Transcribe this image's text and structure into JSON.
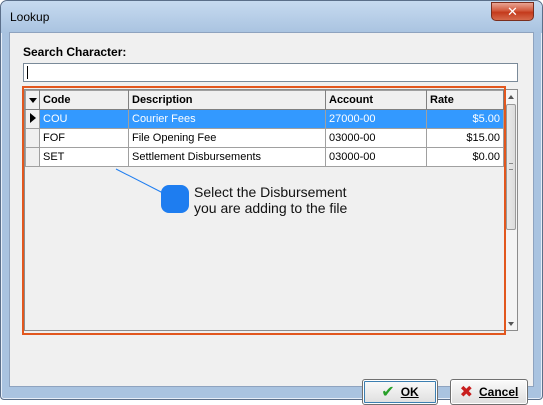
{
  "window": {
    "title": "Lookup",
    "close_label": "✕"
  },
  "search": {
    "label": "Search Character:",
    "value": ""
  },
  "grid": {
    "columns": [
      "Code",
      "Description",
      "Account",
      "Rate"
    ],
    "rows": [
      {
        "code": "COU",
        "description": "Courier Fees",
        "account": "27000-00",
        "rate": "$5.00",
        "selected": true
      },
      {
        "code": "FOF",
        "description": "File Opening Fee",
        "account": "03000-00",
        "rate": "$15.00",
        "selected": false
      },
      {
        "code": "SET",
        "description": "Settlement Disbursements",
        "account": "03000-00",
        "rate": "$0.00",
        "selected": false
      }
    ]
  },
  "callout": {
    "line1": "Select the Disbursement",
    "line2": "you are adding to the file"
  },
  "buttons": {
    "ok_label": "OK",
    "cancel_label": "Cancel"
  },
  "colors": {
    "selection": "#3399ff",
    "highlight_frame": "#e2571e",
    "callout": "#1e7df0"
  }
}
